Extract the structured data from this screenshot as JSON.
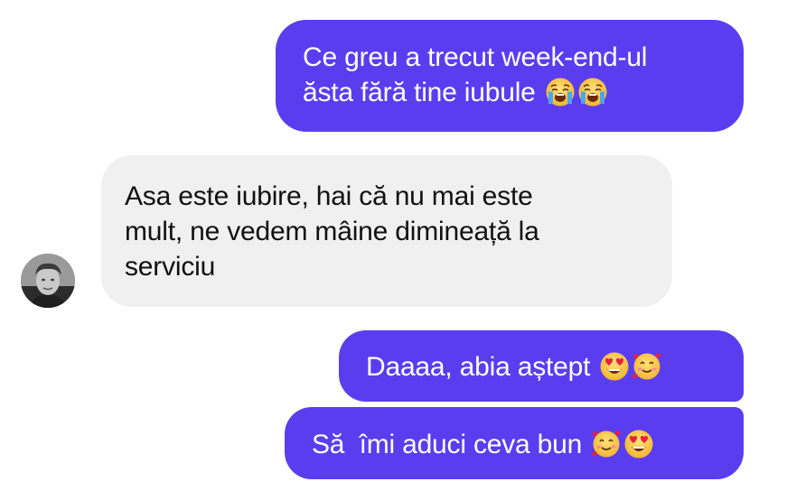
{
  "messages": [
    {
      "direction": "outgoing",
      "line1": "Ce greu a trecut week-end-ul",
      "line2": "ăsta fără tine iubule ",
      "emojis": [
        "loudly-crying-face-icon",
        "loudly-crying-face-icon"
      ]
    },
    {
      "direction": "incoming",
      "line1": "Asa este iubire, hai că nu mai este",
      "line2": "mult, ne vedem mâine dimineață la",
      "line3": "serviciu"
    },
    {
      "direction": "outgoing",
      "line1": "Daaaa, abia aștept ",
      "emojis": [
        "heart-eyes-face-icon",
        "smiling-face-with-hearts-icon"
      ]
    },
    {
      "direction": "outgoing",
      "line1": "Să  îmi aduci ceva bun ",
      "emojis": [
        "smiling-face-with-hearts-icon",
        "heart-eyes-face-icon"
      ]
    }
  ],
  "colors": {
    "outgoing_bubble": "#5b3df0",
    "incoming_bubble": "#f0f0f0",
    "outgoing_text": "#ffffff",
    "incoming_text": "#111111"
  },
  "contact": {
    "avatar_icon": "contact-avatar-photo"
  }
}
